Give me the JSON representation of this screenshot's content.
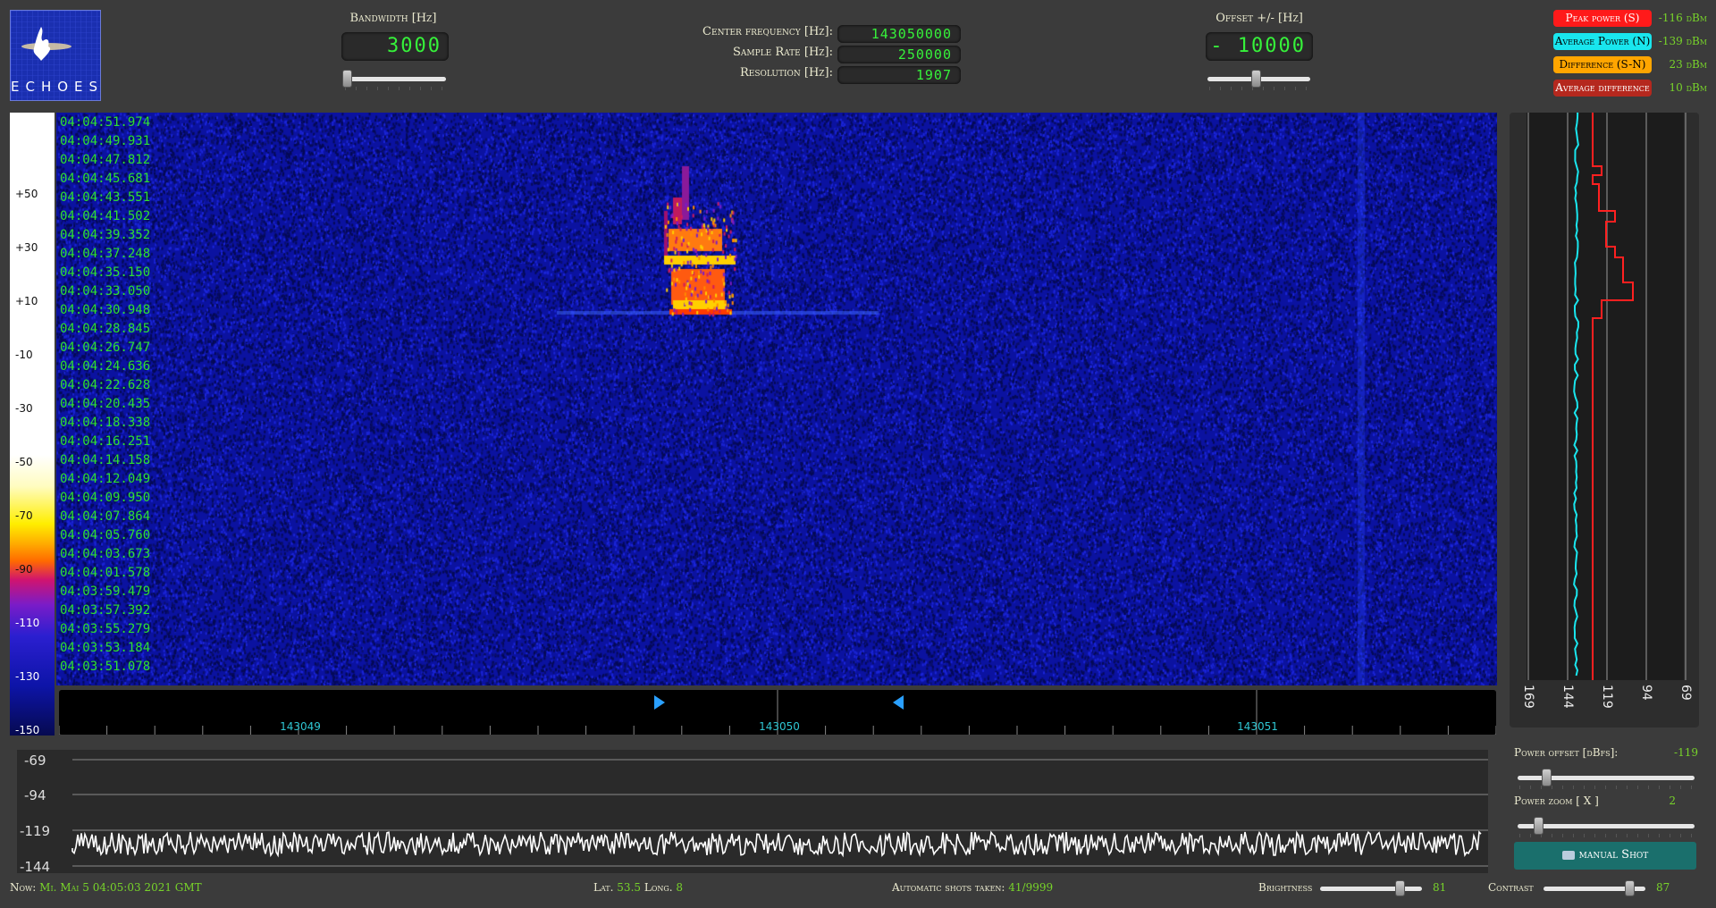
{
  "logo": {
    "text": "ECHOES"
  },
  "bandwidth": {
    "label": "Bandwidth [Hz]",
    "value": "3000",
    "slider_fraction": 0.0
  },
  "center": {
    "center_freq_label": "Center frequency [Hz]:",
    "center_freq_value": "143050000",
    "sample_rate_label": "Sample Rate [Hz]:",
    "sample_rate_value": "250000",
    "resolution_label": "Resolution [Hz]:",
    "resolution_value": "1907"
  },
  "offset": {
    "label": "Offset +/- [Hz]",
    "value": "- 10000",
    "slider_fraction": 0.47
  },
  "stats": [
    {
      "label": "Peak power (S)",
      "value": "-116 dBm",
      "color": "#ff1a1a",
      "text_color": "#ffffff"
    },
    {
      "label": "Average Power (N)",
      "value": "-139 dBm",
      "color": "#19e6ee",
      "text_color": "#000000"
    },
    {
      "label": "Difference (S-N)",
      "value": "23 dBm",
      "color": "#ffa500",
      "text_color": "#000000"
    },
    {
      "label": "Average difference",
      "value": "10 dBm",
      "color": "#b5281e",
      "text_color": "#ffffff"
    }
  ],
  "colorbar": {
    "labels": [
      "+50",
      "+30",
      "+10",
      "-10",
      "-30",
      "-50",
      "-70",
      "-90",
      "-110",
      "-130",
      "-150"
    ]
  },
  "waterfall": {
    "timestamps": [
      "04:04:51.974",
      "04:04:49.931",
      "04:04:47.812",
      "04:04:45.681",
      "04:04:43.551",
      "04:04:41.502",
      "04:04:39.352",
      "04:04:37.248",
      "04:04:35.150",
      "04:04:33.050",
      "04:04:30.948",
      "04:04:28.845",
      "04:04:26.747",
      "04:04:24.636",
      "04:04:22.628",
      "04:04:20.435",
      "04:04:18.338",
      "04:04:16.251",
      "04:04:14.158",
      "04:04:12.049",
      "04:04:09.950",
      "04:04:07.864",
      "04:04:05.760",
      "04:04:03.673",
      "04:04:01.578",
      "04:03:59.479",
      "04:03:57.392",
      "04:03:55.279",
      "04:03:53.184",
      "04:03:51.078"
    ],
    "base_color": "#0d14a8",
    "echo_color": "#ffd000"
  },
  "freq_axis": {
    "labels": [
      "143049",
      "143050",
      "143051"
    ],
    "marker_color": "#2aa0ff"
  },
  "power_panel": {
    "axis_labels": [
      "169",
      "144",
      "119",
      "94",
      "69"
    ],
    "peak_color": "#ff2020",
    "avg_color": "#19e6ee"
  },
  "bottom_chart": {
    "y_labels": [
      "-69",
      "-94",
      "-119",
      "-144"
    ]
  },
  "controls": {
    "power_offset_label": "Power offset [dBfs]:",
    "power_offset_value": "-119",
    "power_offset_fraction": 0.17,
    "power_zoom_label": "Power zoom [ X ]",
    "power_zoom_value": "2",
    "power_zoom_fraction": 0.12,
    "manual_shot_label": "manual Shot"
  },
  "status_bar": {
    "now_label": "Now:",
    "now_value": "Mi. Mai 5 04:05:03 2021 GMT",
    "lat_label": "Lat.",
    "lat_value": "53.5",
    "long_label": "Long.",
    "long_value": "8",
    "shots_label": "Automatic shots taken:",
    "shots_value": "41/9999",
    "brightness_label": "Brightness",
    "brightness_value": "81",
    "contrast_label": "Contrast",
    "contrast_value": "87"
  }
}
